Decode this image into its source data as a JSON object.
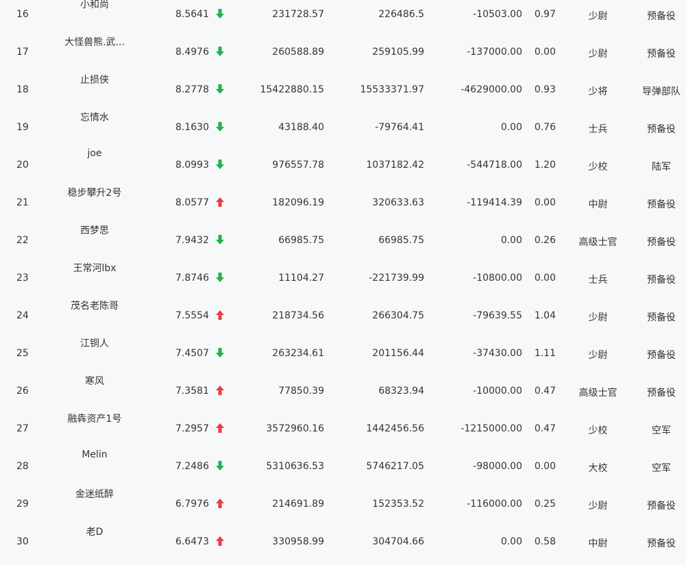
{
  "colors": {
    "up": "#e64040",
    "down": "#21b24a",
    "text": "#333333",
    "background": "#f7f8fa"
  },
  "rows": [
    {
      "rank": "16",
      "name": "小和尚",
      "score": "8.5641",
      "trend": "down",
      "v1": "231728.57",
      "v2": "226486.5",
      "v3": "-10503.00",
      "v4": "0.97",
      "rank_title": "少尉",
      "unit": "预备役"
    },
    {
      "rank": "17",
      "name": "大怪兽熊.武...",
      "score": "8.4976",
      "trend": "down",
      "v1": "260588.89",
      "v2": "259105.99",
      "v3": "-137000.00",
      "v4": "0.00",
      "rank_title": "少尉",
      "unit": "预备役"
    },
    {
      "rank": "18",
      "name": "止损侠",
      "score": "8.2778",
      "trend": "down",
      "v1": "15422880.15",
      "v2": "15533371.97",
      "v3": "-4629000.00",
      "v4": "0.93",
      "rank_title": "少将",
      "unit": "导弹部队"
    },
    {
      "rank": "19",
      "name": "忘情水",
      "score": "8.1630",
      "trend": "down",
      "v1": "43188.40",
      "v2": "-79764.41",
      "v3": "0.00",
      "v4": "0.76",
      "rank_title": "士兵",
      "unit": "预备役"
    },
    {
      "rank": "20",
      "name": "joe",
      "score": "8.0993",
      "trend": "down",
      "v1": "976557.78",
      "v2": "1037182.42",
      "v3": "-544718.00",
      "v4": "1.20",
      "rank_title": "少校",
      "unit": "陆军"
    },
    {
      "rank": "21",
      "name": "稳步攀升2号",
      "score": "8.0577",
      "trend": "up",
      "v1": "182096.19",
      "v2": "320633.63",
      "v3": "-119414.39",
      "v4": "0.00",
      "rank_title": "中尉",
      "unit": "预备役"
    },
    {
      "rank": "22",
      "name": "西梦思",
      "score": "7.9432",
      "trend": "down",
      "v1": "66985.75",
      "v2": "66985.75",
      "v3": "0.00",
      "v4": "0.26",
      "rank_title": "高级士官",
      "unit": "预备役"
    },
    {
      "rank": "23",
      "name": "王常河lbx",
      "score": "7.8746",
      "trend": "down",
      "v1": "11104.27",
      "v2": "-221739.99",
      "v3": "-10800.00",
      "v4": "0.00",
      "rank_title": "士兵",
      "unit": "预备役"
    },
    {
      "rank": "24",
      "name": "茂名老陈哥",
      "score": "7.5554",
      "trend": "up",
      "v1": "218734.56",
      "v2": "266304.75",
      "v3": "-79639.55",
      "v4": "1.04",
      "rank_title": "少尉",
      "unit": "预备役"
    },
    {
      "rank": "25",
      "name": "江铜人",
      "score": "7.4507",
      "trend": "down",
      "v1": "263234.61",
      "v2": "201156.44",
      "v3": "-37430.00",
      "v4": "1.11",
      "rank_title": "少尉",
      "unit": "预备役"
    },
    {
      "rank": "26",
      "name": "寒风",
      "score": "7.3581",
      "trend": "up",
      "v1": "77850.39",
      "v2": "68323.94",
      "v3": "-10000.00",
      "v4": "0.47",
      "rank_title": "高级士官",
      "unit": "预备役"
    },
    {
      "rank": "27",
      "name": "融犇资产1号",
      "score": "7.2957",
      "trend": "up",
      "v1": "3572960.16",
      "v2": "1442456.56",
      "v3": "-1215000.00",
      "v4": "0.47",
      "rank_title": "少校",
      "unit": "空军"
    },
    {
      "rank": "28",
      "name": "Melin",
      "score": "7.2486",
      "trend": "down",
      "v1": "5310636.53",
      "v2": "5746217.05",
      "v3": "-98000.00",
      "v4": "0.00",
      "rank_title": "大校",
      "unit": "空军"
    },
    {
      "rank": "29",
      "name": "金迷纸醉",
      "score": "6.7976",
      "trend": "up",
      "v1": "214691.89",
      "v2": "152353.52",
      "v3": "-116000.00",
      "v4": "0.25",
      "rank_title": "少尉",
      "unit": "预备役"
    },
    {
      "rank": "30",
      "name": "老D",
      "score": "6.6473",
      "trend": "up",
      "v1": "330958.99",
      "v2": "304704.66",
      "v3": "0.00",
      "v4": "0.58",
      "rank_title": "中尉",
      "unit": "预备役"
    }
  ]
}
